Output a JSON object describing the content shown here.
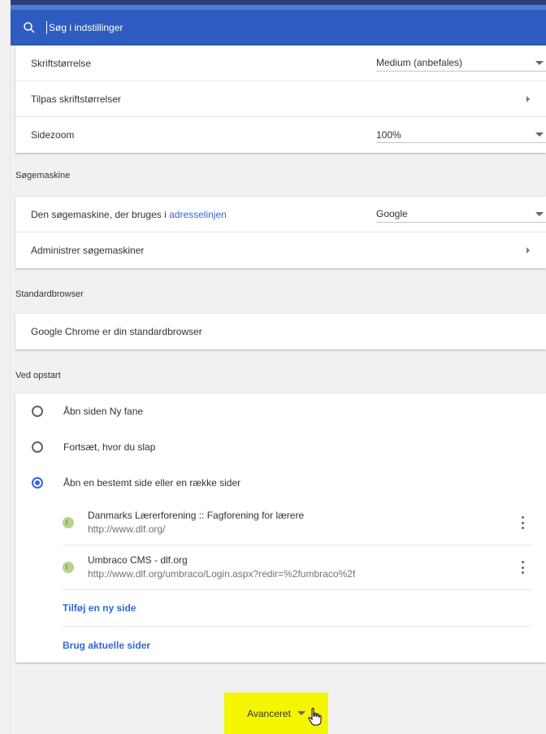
{
  "search": {
    "placeholder": "Søg i indstillinger"
  },
  "appearance": {
    "font_size_label": "Skriftstørrelse",
    "font_size_value": "Medium (anbefales)",
    "customize_fonts_label": "Tilpas skriftstørrelser",
    "page_zoom_label": "Sidezoom",
    "page_zoom_value": "100%"
  },
  "search_engine": {
    "section_title": "Søgemaskine",
    "engine_label_prefix": "Den søgemaskine, der bruges i ",
    "engine_label_link": "adresselinjen",
    "engine_value": "Google",
    "manage_label": "Administrer søgemaskiner"
  },
  "default_browser": {
    "section_title": "Standardbrowser",
    "status_text": "Google Chrome er din standardbrowser"
  },
  "startup": {
    "section_title": "Ved opstart",
    "options": [
      {
        "label": "Åbn siden Ny fane",
        "selected": false
      },
      {
        "label": "Fortsæt, hvor du slap",
        "selected": false
      },
      {
        "label": "Åbn en bestemt side eller en række sider",
        "selected": true
      }
    ],
    "pages": [
      {
        "title": "Danmarks Lærerforening :: Fagforening for lærere",
        "url": "http://www.dlf.org/"
      },
      {
        "title": "Umbraco CMS - dlf.org",
        "url": "http://www.dlf.org/umbraco/Login.aspx?redir=%2fumbraco%2f"
      }
    ],
    "add_page_label": "Tilføj en ny side",
    "use_current_label": "Brug aktuelle sider"
  },
  "advanced_label": "Avanceret",
  "colors": {
    "accent": "#3367d6",
    "header": "#2e5bbf",
    "highlight": "#f5f500"
  }
}
